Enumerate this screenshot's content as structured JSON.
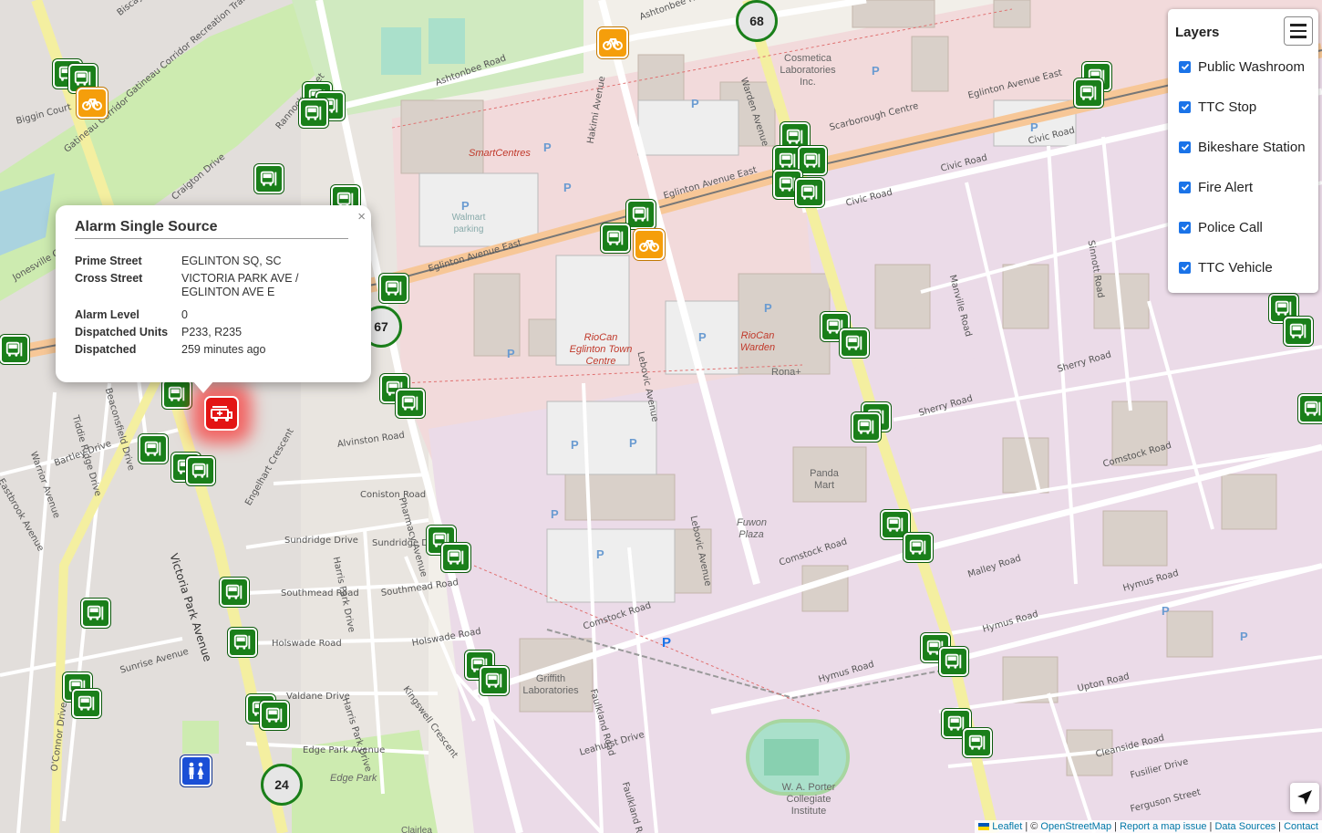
{
  "popup": {
    "title": "Alarm Single Source",
    "close": "×",
    "rows": [
      {
        "key": "Prime Street",
        "value": "EGLINTON SQ, SC"
      },
      {
        "key": "Cross Street",
        "value": "VICTORIA PARK AVE / EGLINTON AVE E"
      },
      {
        "key": "Alarm Level",
        "value": "0"
      },
      {
        "key": "Dispatched Units",
        "value": "P233, R235"
      },
      {
        "key": "Dispatched",
        "value": "259 minutes ago"
      }
    ]
  },
  "layers": {
    "title": "Layers",
    "items": [
      {
        "label": "Public Washroom",
        "checked": true
      },
      {
        "label": "TTC Stop",
        "checked": true
      },
      {
        "label": "Bikeshare Station",
        "checked": true
      },
      {
        "label": "Fire Alert",
        "checked": true
      },
      {
        "label": "Police Call",
        "checked": true
      },
      {
        "label": "TTC Vehicle",
        "checked": true
      }
    ]
  },
  "clusters": [
    "68",
    "67",
    "24"
  ],
  "attribution": {
    "leaflet": "Leaflet",
    "sep1": " | © ",
    "osm": "OpenStreetMap",
    "report": "Report a map issue",
    "sources": "Data Sources",
    "contact": "Contact"
  },
  "streets": [
    "Biscayne Boulevard",
    "Gatineau Corridor Recreation Trail",
    "Ashtonbee Road",
    "Ashtonbee Road",
    "Biggin Court",
    "Rannock Street",
    "Craigton Drive",
    "Jonesville Crescent",
    "Hakimi Avenue",
    "Warden Avenue",
    "Eglinton Avenue East",
    "Eglinton Avenue East",
    "Eglinton Avenue East",
    "Scarborough Centre",
    "Civic Road",
    "Civic Road",
    "Civic Road",
    "Manville Road",
    "Sinnott Road",
    "Sherry Road",
    "Sherry Road",
    "Lebovic Avenue",
    "Lebovic Avenue",
    "Pharmacy Avenue",
    "Alvinston Road",
    "Coniston Road",
    "Victoria Park Avenue",
    "Sundridge Drive",
    "Sundridge Drive",
    "Harris Park Drive",
    "Harris Park Drive",
    "Southmead Road",
    "Southmead Road",
    "Holswade Road",
    "Holswade Road",
    "Sunrise Avenue",
    "Valdane Drive",
    "Kingswell Crescent",
    "Edge Park Avenue",
    "Comstock Road",
    "Comstock Road",
    "Comstock Road",
    "Malley Road",
    "Hymus Road",
    "Hymus Road",
    "Hymus Road",
    "Upton Road",
    "Faulkland Road",
    "Faulkland Road",
    "Leahurst Drive",
    "Cleanside Road",
    "Fusilier Drive",
    "Ferguson Street",
    "O'Connor Drive",
    "Bartley Drive",
    "Warrior Avenue",
    "Eastbrook Avenue",
    "Engelhart Crescent",
    "Tiddie Ridge Drive",
    "Beaconsfield Drive",
    "Gatineau Corridor",
    "Cosmetica Laboratories Inc."
  ],
  "places": [
    "SmartCentres",
    "RioCan Eglinton Town Centre",
    "RioCan Warden",
    "Rona+",
    "Panda Mart",
    "Fuwon Plaza",
    "Griffith Laboratories",
    "W. A. Porter Collegiate Institute",
    "Edge Park",
    "Walmart parking",
    "Clairlea"
  ],
  "colors": {
    "ttc": "#1a7f1a",
    "bike": "#f59e0b",
    "fire": "#e31414",
    "washroom": "#1a4fd6",
    "checkbox": "#1a73e8"
  }
}
